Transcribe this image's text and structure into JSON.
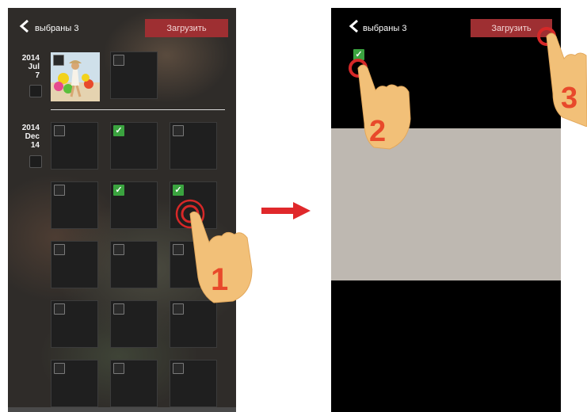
{
  "topbar": {
    "selected_label": "выбраны 3",
    "upload_label": "Загрузить"
  },
  "groups": [
    {
      "year": "2014",
      "month": "Jul",
      "day": "7"
    },
    {
      "year": "2014",
      "month": "Dec",
      "day": "14"
    }
  ],
  "grid": {
    "first_group_cells": [
      {
        "type": "photo",
        "checked": false
      },
      {
        "type": "empty",
        "checked": false
      }
    ],
    "second_group_rows": [
      [
        false,
        true,
        false
      ],
      [
        false,
        true,
        true
      ],
      [
        false,
        false,
        false
      ],
      [
        false,
        false,
        false
      ],
      [
        false,
        false,
        false
      ]
    ]
  },
  "steps": [
    "1",
    "2",
    "3"
  ],
  "colors": {
    "upload_bg": "#9e2f32",
    "checkbox_on": "#3aa33f",
    "step_number": "#e8492b",
    "hand": "#f2c078",
    "tap_ring": "#d62828",
    "transition_arrow": "#e0282b"
  }
}
